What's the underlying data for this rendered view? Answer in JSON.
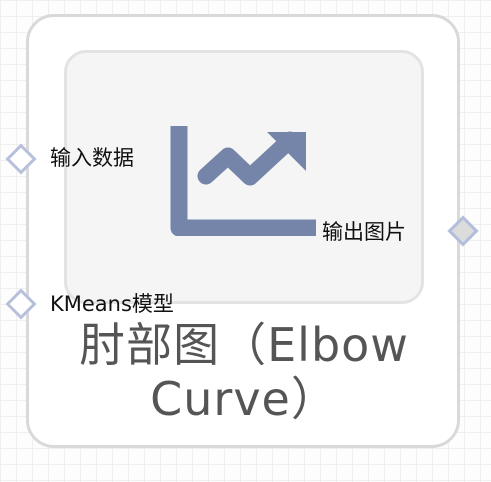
{
  "node": {
    "title": "肘部图（Elbow Curve）",
    "icon": "trending-up-chart-icon"
  },
  "ports": {
    "inputs": [
      {
        "label": "输入数据"
      },
      {
        "label": "KMeans模型"
      }
    ],
    "outputs": [
      {
        "label": "输出图片"
      }
    ]
  },
  "colors": {
    "icon": "#7585aa",
    "port_border": "#b6bfdc",
    "title": "#555555",
    "node_border": "#d9d9d9"
  }
}
